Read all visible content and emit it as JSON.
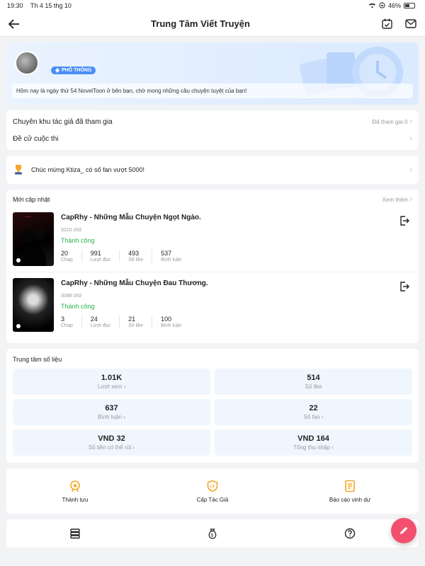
{
  "status": {
    "time": "19:30",
    "date": "Th 4 15 thg 10",
    "battery": "46%"
  },
  "header": {
    "title": "Trung Tâm Viết Truyện"
  },
  "profile": {
    "badge": "PHỔ THÔNG",
    "message": "Hôm nay là ngày thứ 54 NovelToon ở bên bạn, chờ mong những câu chuyện tuyệt của bạn!"
  },
  "menu": {
    "zone_label": "Chuyên khu tác giả đã tham gia",
    "zone_value": "Đã tham gia 0",
    "contest_label": "Đề cử cuộc thi"
  },
  "notice": {
    "text": "Chúc mừng  Ktiza_ có số fan vượt 5000!"
  },
  "updates": {
    "title": "Mới cập nhật",
    "more": "Xem thêm",
    "stories": [
      {
        "title": "CapRhy - Những Mẫu Chuyện Ngọt Ngào.",
        "words": "9210 chữ",
        "status": "Thành công",
        "stats": [
          {
            "value": "20",
            "label": "Chap"
          },
          {
            "value": "991",
            "label": "Lượt đọc"
          },
          {
            "value": "493",
            "label": "Số like"
          },
          {
            "value": "537",
            "label": "Bình luận"
          }
        ]
      },
      {
        "title": "CapRhy - Những Mẫu Chuyện Đau Thương.",
        "words": "3088 chữ",
        "status": "Thành công",
        "stats": [
          {
            "value": "3",
            "label": "Chap"
          },
          {
            "value": "24",
            "label": "Lượt đọc"
          },
          {
            "value": "21",
            "label": "Số like"
          },
          {
            "value": "100",
            "label": "Bình luận"
          }
        ]
      }
    ]
  },
  "data_center": {
    "title": "Trung tâm số liệu",
    "cells": [
      {
        "value": "1.01K",
        "label": "Lượt xem"
      },
      {
        "value": "514",
        "label": "Số like"
      },
      {
        "value": "637",
        "label": "Bình luận"
      },
      {
        "value": "22",
        "label": "Số fan"
      },
      {
        "value": "VND 32",
        "label": "Số tiền có thể rút"
      },
      {
        "value": "VND 164",
        "label": "Tổng thu nhập"
      }
    ]
  },
  "tools": [
    {
      "label": "Thành tựu",
      "icon": "medal-icon"
    },
    {
      "label": "Cấp Tác Giả",
      "icon": "level-shield-icon"
    },
    {
      "label": "Báo cáo vinh dự",
      "icon": "report-icon"
    }
  ],
  "tools2": [
    {
      "icon": "stack-icon"
    },
    {
      "icon": "money-bag-icon"
    },
    {
      "icon": "help-icon"
    }
  ],
  "colors": {
    "accent": "#f5a623",
    "success": "#2db24a",
    "fab": "#f2506e",
    "badge": "#4a8ef7"
  }
}
